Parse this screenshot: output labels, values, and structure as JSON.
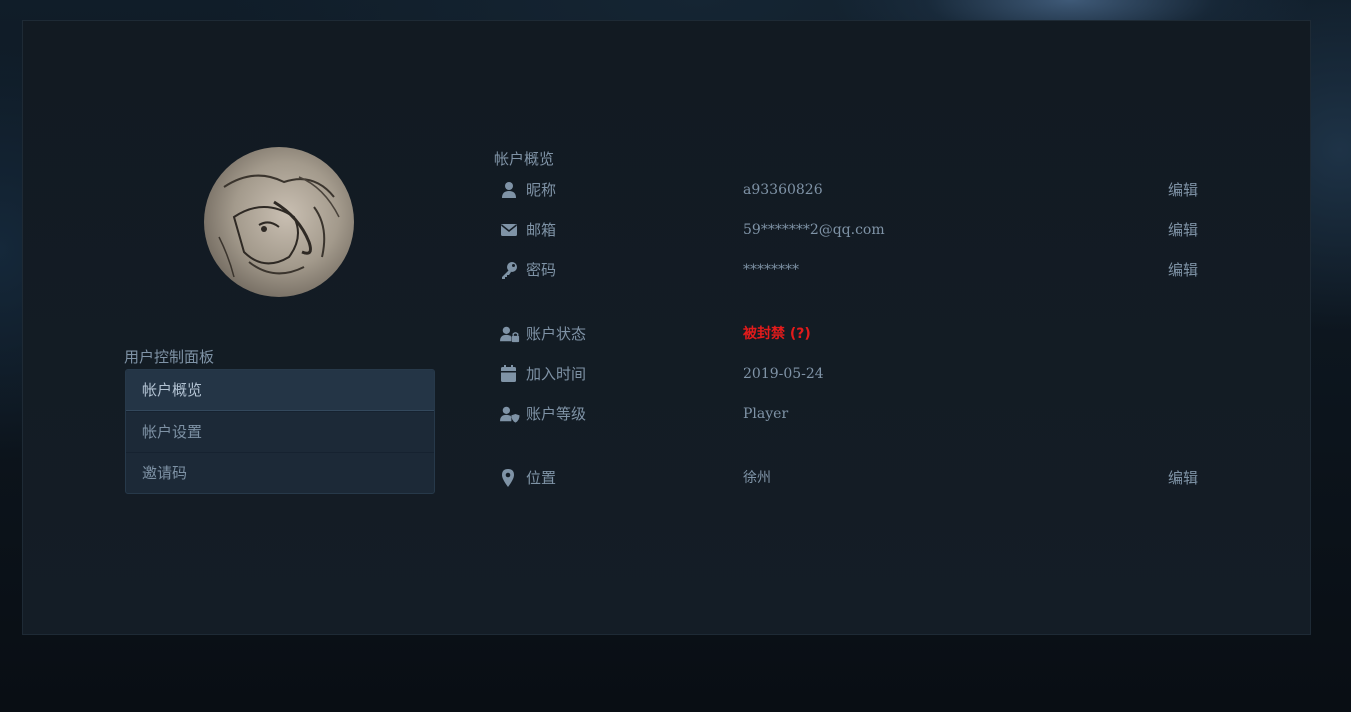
{
  "sidebar": {
    "title": "用户控制面板",
    "items": [
      {
        "label": "帐户概览",
        "active": true
      },
      {
        "label": "帐户设置",
        "active": false
      },
      {
        "label": "邀请码",
        "active": false
      }
    ]
  },
  "overview": {
    "title": "帐户概览",
    "rows": [
      {
        "icon": "user-icon",
        "label": "昵称",
        "value": "a93360826",
        "edit": "编辑"
      },
      {
        "icon": "envelope-icon",
        "label": "邮箱",
        "value": "59*******2@qq.com",
        "edit": "编辑"
      },
      {
        "icon": "key-icon",
        "label": "密码",
        "value": "********",
        "edit": "编辑"
      },
      {
        "icon": "user-lock-icon",
        "label": "账户状态",
        "value": "被封禁 (?)",
        "edit": ""
      },
      {
        "icon": "calendar-icon",
        "label": "加入时间",
        "value": "2019-05-24",
        "edit": ""
      },
      {
        "icon": "user-shield-icon",
        "label": "账户等级",
        "value": "Player",
        "edit": ""
      },
      {
        "icon": "map-marker-icon",
        "label": "位置",
        "value": "徐州",
        "edit": "编辑"
      }
    ]
  },
  "colors": {
    "banned": "#e21b1b",
    "text": "#7f93a6",
    "panel": "#121a22"
  }
}
